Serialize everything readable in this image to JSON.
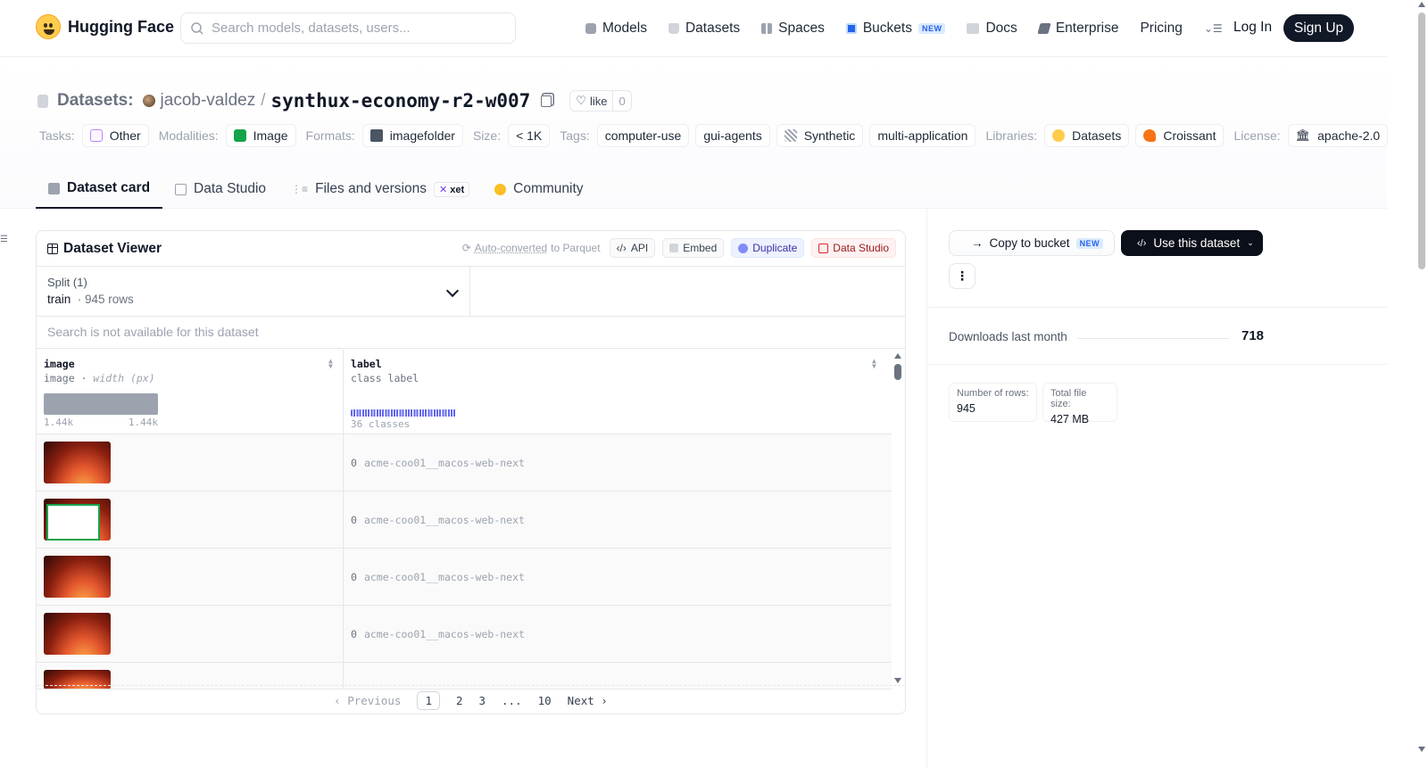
{
  "header": {
    "logo_text": "Hugging Face",
    "search_placeholder": "Search models, datasets, users...",
    "nav": [
      {
        "label": "Models",
        "icon": "cube-icon"
      },
      {
        "label": "Datasets",
        "icon": "database-icon"
      },
      {
        "label": "Spaces",
        "icon": "grid-icon"
      },
      {
        "label": "Buckets",
        "icon": "bucket-icon",
        "badge": "NEW"
      },
      {
        "label": "Docs",
        "icon": "book-icon"
      },
      {
        "label": "Enterprise",
        "icon": "enterprise-icon"
      },
      {
        "label": "Pricing"
      }
    ],
    "login": "Log In",
    "signup": "Sign Up"
  },
  "dataset": {
    "prefix": "Datasets:",
    "owner": "jacob-valdez",
    "name": "synthux-economy-r2-w007",
    "like_label": "like",
    "like_count": "0"
  },
  "tags": {
    "tasks_label": "Tasks:",
    "tasks": "Other",
    "modalities_label": "Modalities:",
    "modalities": "Image",
    "formats_label": "Formats:",
    "formats": "imagefolder",
    "size_label": "Size:",
    "size": "< 1K",
    "tags_label": "Tags:",
    "tag_list": [
      "computer-use",
      "gui-agents",
      "Synthetic",
      "multi-application"
    ],
    "libraries_label": "Libraries:",
    "libraries": [
      "Datasets",
      "Croissant"
    ],
    "license_label": "License:",
    "license": "apache-2.0"
  },
  "tabs": [
    {
      "label": "Dataset card",
      "active": true
    },
    {
      "label": "Data Studio"
    },
    {
      "label": "Files and versions",
      "badge": "xet"
    },
    {
      "label": "Community"
    }
  ],
  "viewer": {
    "title": "Dataset Viewer",
    "auto_converted": "Auto-converted",
    "auto_converted_suffix": "to Parquet",
    "api": "API",
    "embed": "Embed",
    "duplicate": "Duplicate",
    "data_studio": "Data Studio",
    "split_label": "Split (1)",
    "split_value": "train",
    "split_rows": "945 rows",
    "search_na": "Search is not available for this dataset",
    "columns": [
      {
        "name": "image",
        "type": "image",
        "type_extra": "width (px)",
        "hist_min": "1.44k",
        "hist_max": "1.44k"
      },
      {
        "name": "label",
        "type": "class label",
        "classes": "36 classes"
      }
    ],
    "rows": [
      {
        "label_id": "0",
        "label": "acme-coo01__macos-web-next",
        "thumb": "wallpaper"
      },
      {
        "label_id": "0",
        "label": "acme-coo01__macos-web-next",
        "thumb": "window"
      },
      {
        "label_id": "0",
        "label": "acme-coo01__macos-web-next",
        "thumb": "wallpaper"
      },
      {
        "label_id": "0",
        "label": "acme-coo01__macos-web-next",
        "thumb": "wallpaper"
      }
    ],
    "pager": {
      "prev": "Previous",
      "pages": [
        "1",
        "2",
        "3",
        "...",
        "10"
      ],
      "next": "Next",
      "current": "1"
    }
  },
  "sidebar": {
    "copy_to_bucket": "Copy to bucket",
    "new_badge": "NEW",
    "use_dataset": "Use this dataset",
    "downloads_label": "Downloads last month",
    "downloads_value": "718",
    "rows_label": "Number of rows:",
    "rows_value": "945",
    "filesize_label": "Total file size:",
    "filesize_value": "427 MB"
  }
}
